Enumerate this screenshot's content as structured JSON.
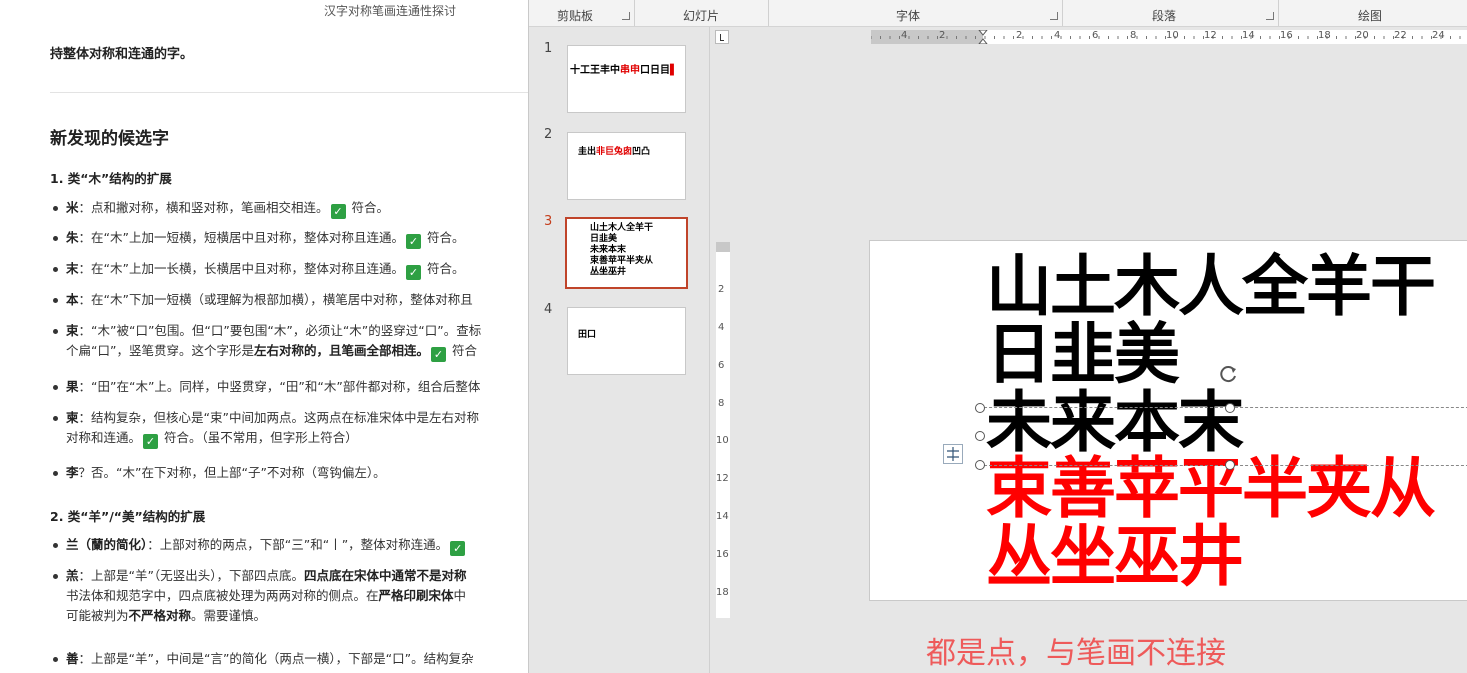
{
  "document": {
    "title": "汉字对称笔画连通性探讨",
    "intro": "持整体对称和连通的字。",
    "heading": "新发现的候选字",
    "sections": [
      {
        "title": "1. 类“木”结构的扩展",
        "items": [
          {
            "char": "米",
            "text": "：点和撇对称，横和竖对称，笔画相交相连。",
            "check": "✓",
            "after": " 符合。"
          },
          {
            "char": "朱",
            "text": "：在“木”上加一短横，短横居中且对称，整体对称且连通。",
            "check": "✓",
            "after": " 符合。"
          },
          {
            "char": "末",
            "text": "：在“木”上加一长横，长横居中且对称，整体对称且连通。",
            "check": "✓",
            "after": " 符合。"
          },
          {
            "char": "本",
            "text": "：在“木”下加一短横（或理解为根部加横），横笔居中对称，整体对称且"
          },
          {
            "char": "束",
            "text": "：“木”被“口”包围。但“口”要包围“木”，必须让“木”的竖穿过“口”。查标",
            "line2_pre": "个扁“口”，竖笔贯穿。这个字形是",
            "line2_bold": "左右对称的，且笔画全部相连。",
            "line2_check": "✓",
            "line2_after": " 符合"
          },
          {
            "char": "果",
            "text": "：“田”在“木”上。同样，中竖贯穿，“田”和“木”部件都对称，组合后整体"
          },
          {
            "char": "柬",
            "text": "：结构复杂，但核心是“束”中间加两点。这两点在标准宋体中是左右对称",
            "line2_pre": "对称和连通。",
            "line2_check": "✓",
            "line2_after": " 符合。（虽不常用，但字形上符合）"
          },
          {
            "char": "李",
            "text": "？否。“木”在下对称，但上部“子”不对称（弯钩偏左）。"
          }
        ]
      },
      {
        "title": "2. 类“羊”/“美”结构的扩展",
        "items": [
          {
            "char": "兰（蘭的简化）",
            "text": "：上部对称的两点，下部“三”和“丨”，整体对称连通。",
            "check": "✓"
          },
          {
            "char": "羔",
            "text": "：上部是“羊”（无竖出头），下部四点底。",
            "bold_after": "四点底在宋体中通常不是对称",
            "line2_pre": "书法体和规范字中，四点底被处理为两两对称的侧点。在",
            "line2_bold": "严格印刷宋体",
            "line2_after": "中",
            "line3_pre": "可能被判为",
            "line3_bold": "不严格对称",
            "line3_after": "。需要谨慎。"
          },
          {
            "char": "善",
            "text": "：上部是“羊”，中间是“言”的简化（两点一横），下部是“口”。结构复杂"
          }
        ]
      }
    ]
  },
  "ribbon": {
    "groups": [
      "剪贴板",
      "幻灯片",
      "字体",
      "段落",
      "绘图"
    ]
  },
  "thumbnails": [
    {
      "num": "1",
      "lines": [
        [
          {
            "t": "十工王丰中",
            "red": false
          },
          {
            "t": "串申",
            "red": true
          },
          {
            "t": "口日目",
            "red": false
          },
          {
            "t": "▌",
            "red": true
          }
        ]
      ]
    },
    {
      "num": "2",
      "lines": [
        [
          {
            "t": "圭出",
            "red": false
          },
          {
            "t": "非巨",
            "red": true
          },
          {
            "t": "兔囱",
            "red": true
          },
          {
            "t": "凹凸",
            "red": false
          }
        ]
      ]
    },
    {
      "num": "3",
      "lines": [
        [
          {
            "t": "山土木人全羊干",
            "red": false
          }
        ],
        [
          {
            "t": "日韭美",
            "red": false
          }
        ],
        [
          {
            "t": "未来本末",
            "red": false
          }
        ],
        [
          {
            "t": "束善苹平半夹从",
            "red": true
          }
        ],
        [
          {
            "t": "丛坐巫井",
            "red": true
          }
        ]
      ]
    },
    {
      "num": "4",
      "lines": [
        [
          {
            "t": "田口",
            "red": false
          }
        ]
      ]
    }
  ],
  "rulers": {
    "horizontal": [
      "4",
      "2",
      "2",
      "4",
      "6",
      "8",
      "10",
      "12",
      "14",
      "16",
      "18",
      "20",
      "22",
      "24"
    ],
    "vertical": [
      "2",
      "4",
      "6",
      "8",
      "10",
      "12",
      "14",
      "16",
      "18"
    ]
  },
  "slide": {
    "lines": [
      {
        "text": "山土木人全羊干",
        "color": "#000000"
      },
      {
        "text": "日韭美",
        "color": "#000000"
      },
      {
        "text": "未来本末",
        "color": "#000000"
      },
      {
        "text": "束善苹平半夹从",
        "color": "#ff0000"
      },
      {
        "text": "丛坐巫井",
        "color": "#ff0000"
      }
    ]
  },
  "annotation": "都是点，与笔画不连接",
  "colors": {
    "accent": "#c43e1c",
    "check": "#2ea043",
    "annotation": "#ee5a5a",
    "slide_red": "#ff0000"
  }
}
